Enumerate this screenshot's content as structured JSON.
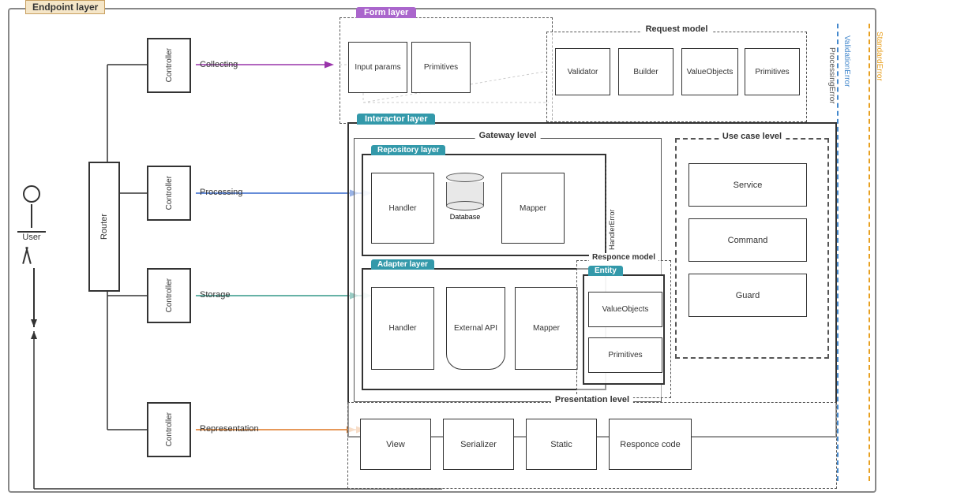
{
  "layers": {
    "endpoint": "Endpoint layer",
    "form": "Form layer",
    "interactor": "Interactor layer",
    "repository": "Repository layer",
    "adapter": "Adapter layer",
    "gateway": "Gateway level",
    "usecase": "Use case level",
    "responce_model": "Responce model",
    "presentation": "Presentation level",
    "request_model": "Request model"
  },
  "user": "User",
  "router": "Router",
  "controllers": [
    "Controller",
    "Controller",
    "Controller",
    "Controller"
  ],
  "actions": [
    "Collecting",
    "Processing",
    "Storage",
    "Representation"
  ],
  "form_boxes": [
    "Input params",
    "Primitives"
  ],
  "request_model_boxes": [
    "Validator",
    "Builder",
    "ValueObjects",
    "Primitives"
  ],
  "repo_boxes": [
    "Handler",
    "Database",
    "Mapper"
  ],
  "adapter_boxes": [
    "Handler",
    "External API",
    "Mapper"
  ],
  "usecase_boxes": [
    "Service",
    "Command",
    "Guard"
  ],
  "entity_boxes": [
    "ValueObjects",
    "Primitives"
  ],
  "presentation_boxes": [
    "View",
    "Serializer",
    "Static",
    "Responce code"
  ],
  "errors": {
    "handler_error": "HandlerError",
    "processing_error": "ProcessingError",
    "validation_error": "ValidationError",
    "standard_error": "StandardError"
  },
  "entity_label": "Entity"
}
